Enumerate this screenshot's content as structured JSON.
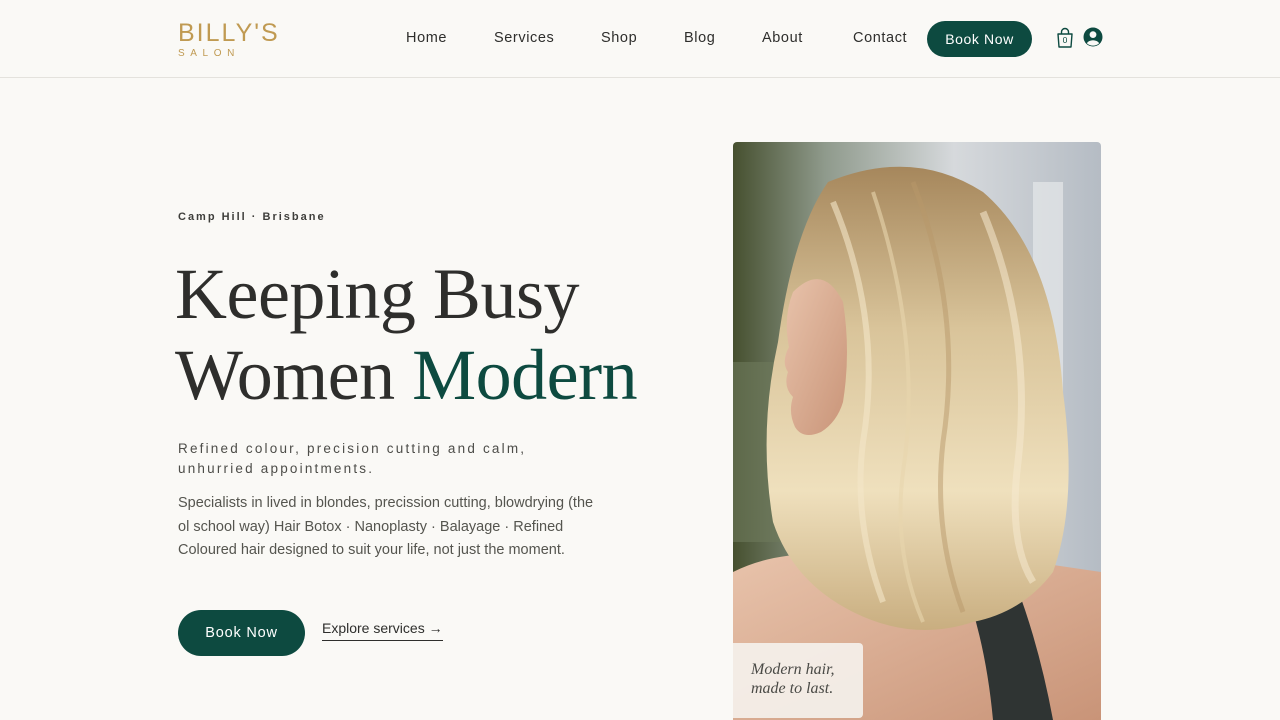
{
  "brand": {
    "name": "BILLY'S",
    "subtitle": "SALON",
    "color": "#c09a52"
  },
  "nav": {
    "items": [
      {
        "label": "Home"
      },
      {
        "label": "Services"
      },
      {
        "label": "Shop"
      },
      {
        "label": "Blog"
      },
      {
        "label": "About"
      },
      {
        "label": "Contact"
      }
    ],
    "book_button": "Book Now",
    "cart_count": "0",
    "cart_icon": "shopping-bag-icon",
    "user_icon": "user-account-icon"
  },
  "hero": {
    "location": "Camp Hill · Brisbane",
    "headline_line1": "Keeping Busy",
    "headline_line2_plain": "Women ",
    "headline_line2_accent": "Modern",
    "tagline": "Refined colour, precision cutting and calm, unhurried appointments.",
    "description": "Specialists in lived in blondes, precission cutting, blowdrying (the ol school way) Hair Botox · Nanoplasty · Balayage · Refined Coloured hair designed to suit your life, not just the moment.",
    "book_button": "Book Now",
    "explore_link": "Explore services →",
    "image_caption": "Modern hair,\nmade to last."
  },
  "colors": {
    "primary": "#0d4a40",
    "background": "#faf9f6",
    "text": "#2e2e2c",
    "gold": "#c09a52"
  }
}
